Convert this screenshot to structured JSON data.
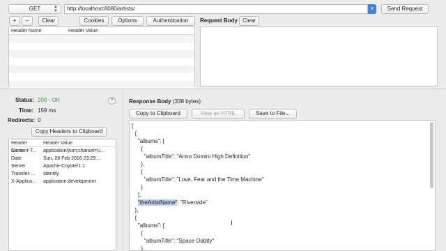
{
  "request": {
    "method": "GET",
    "url": "http://localhost:8080/artists/",
    "send_label": "Send Request"
  },
  "header_toolbar": {
    "add_label": "+",
    "remove_label": "−",
    "clear_label": "Clear",
    "cookies_label": "Cookies",
    "options_label": "Options",
    "auth_label": "Authentication"
  },
  "request_headers_table": {
    "col_name": "Header Name",
    "col_value": "Header Value"
  },
  "request_body": {
    "title": "Request Body",
    "clear_label": "Clear"
  },
  "status": {
    "status_label": "Status:",
    "status_value": "200 - OK",
    "time_label": "Time:",
    "time_value": "159 ms",
    "redirects_label": "Redirects:",
    "redirects_value": "0",
    "help_label": "?",
    "copy_headers_label": "Copy Headers to Clipboard",
    "status_color": "#2e9b2e"
  },
  "response_headers": {
    "col_name": "Header Name",
    "col_value": "Header Value",
    "rows": [
      {
        "name": "Content-T...",
        "value": "application/json;charset=U..."
      },
      {
        "name": "Date",
        "value": "Sun, 28 Feb 2016 23:29:..."
      },
      {
        "name": "Server",
        "value": "Apache-Coyote/1.1"
      },
      {
        "name": "Transfer-...",
        "value": "Identity"
      },
      {
        "name": "X-Applica...",
        "value": "application:development"
      }
    ]
  },
  "response_body": {
    "title": "Response Body",
    "size": "(338 bytes)",
    "copy_label": "Copy to Clipboard",
    "view_html_label": "View as HTML",
    "save_label": "Save to File...",
    "lines": [
      "[",
      "  {",
      "    \"albums\": [",
      "      {",
      "        \"albumTitle\": \"Anno Domini High Definition\"",
      "      },",
      "      {",
      "        \"albumTitle\": \"Love, Fear and the Time Machine\"",
      "      }",
      "    ],",
      "    \"theArtistName\": \"Riverside\"",
      "  },",
      "  {",
      "    \"albums\": [",
      "      {",
      "        \"albumTitle\": \"Space Oddity\"",
      "      },",
      "      {"
    ]
  },
  "icons": {
    "dropdown": "chevron-down-icon",
    "method_stepper": "up-down-arrows-icon",
    "help": "help-icon",
    "text_cursor": "i-beam-cursor-icon"
  }
}
